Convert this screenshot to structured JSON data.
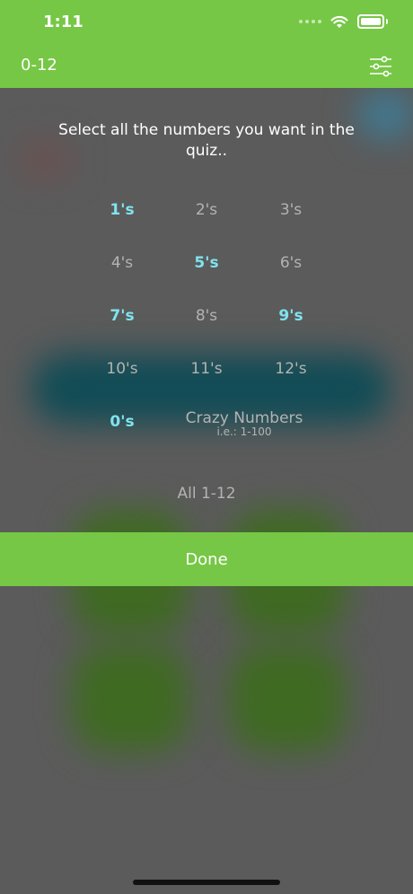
{
  "status_bar": {
    "time": "1:11"
  },
  "nav": {
    "title": "0-12",
    "settings_icon": "sliders-icon"
  },
  "picker": {
    "prompt": "Select all the numbers you want in the quiz..",
    "options": [
      {
        "label": "1's",
        "selected": true
      },
      {
        "label": "2's",
        "selected": false
      },
      {
        "label": "3's",
        "selected": false
      },
      {
        "label": "4's",
        "selected": false
      },
      {
        "label": "5's",
        "selected": true
      },
      {
        "label": "6's",
        "selected": false
      },
      {
        "label": "7's",
        "selected": true
      },
      {
        "label": "8's",
        "selected": false
      },
      {
        "label": "9's",
        "selected": true
      },
      {
        "label": "10's",
        "selected": false
      },
      {
        "label": "11's",
        "selected": false
      },
      {
        "label": "12's",
        "selected": false
      },
      {
        "label": "0's",
        "selected": true
      }
    ],
    "crazy": {
      "title": "Crazy Numbers",
      "subtitle": "i.e.: 1-100"
    },
    "all_label": "All 1-12",
    "done_label": "Done"
  },
  "colors": {
    "accent": "#76c745",
    "selected": "#7fe4ef",
    "unselected": "#b3b3b3"
  }
}
